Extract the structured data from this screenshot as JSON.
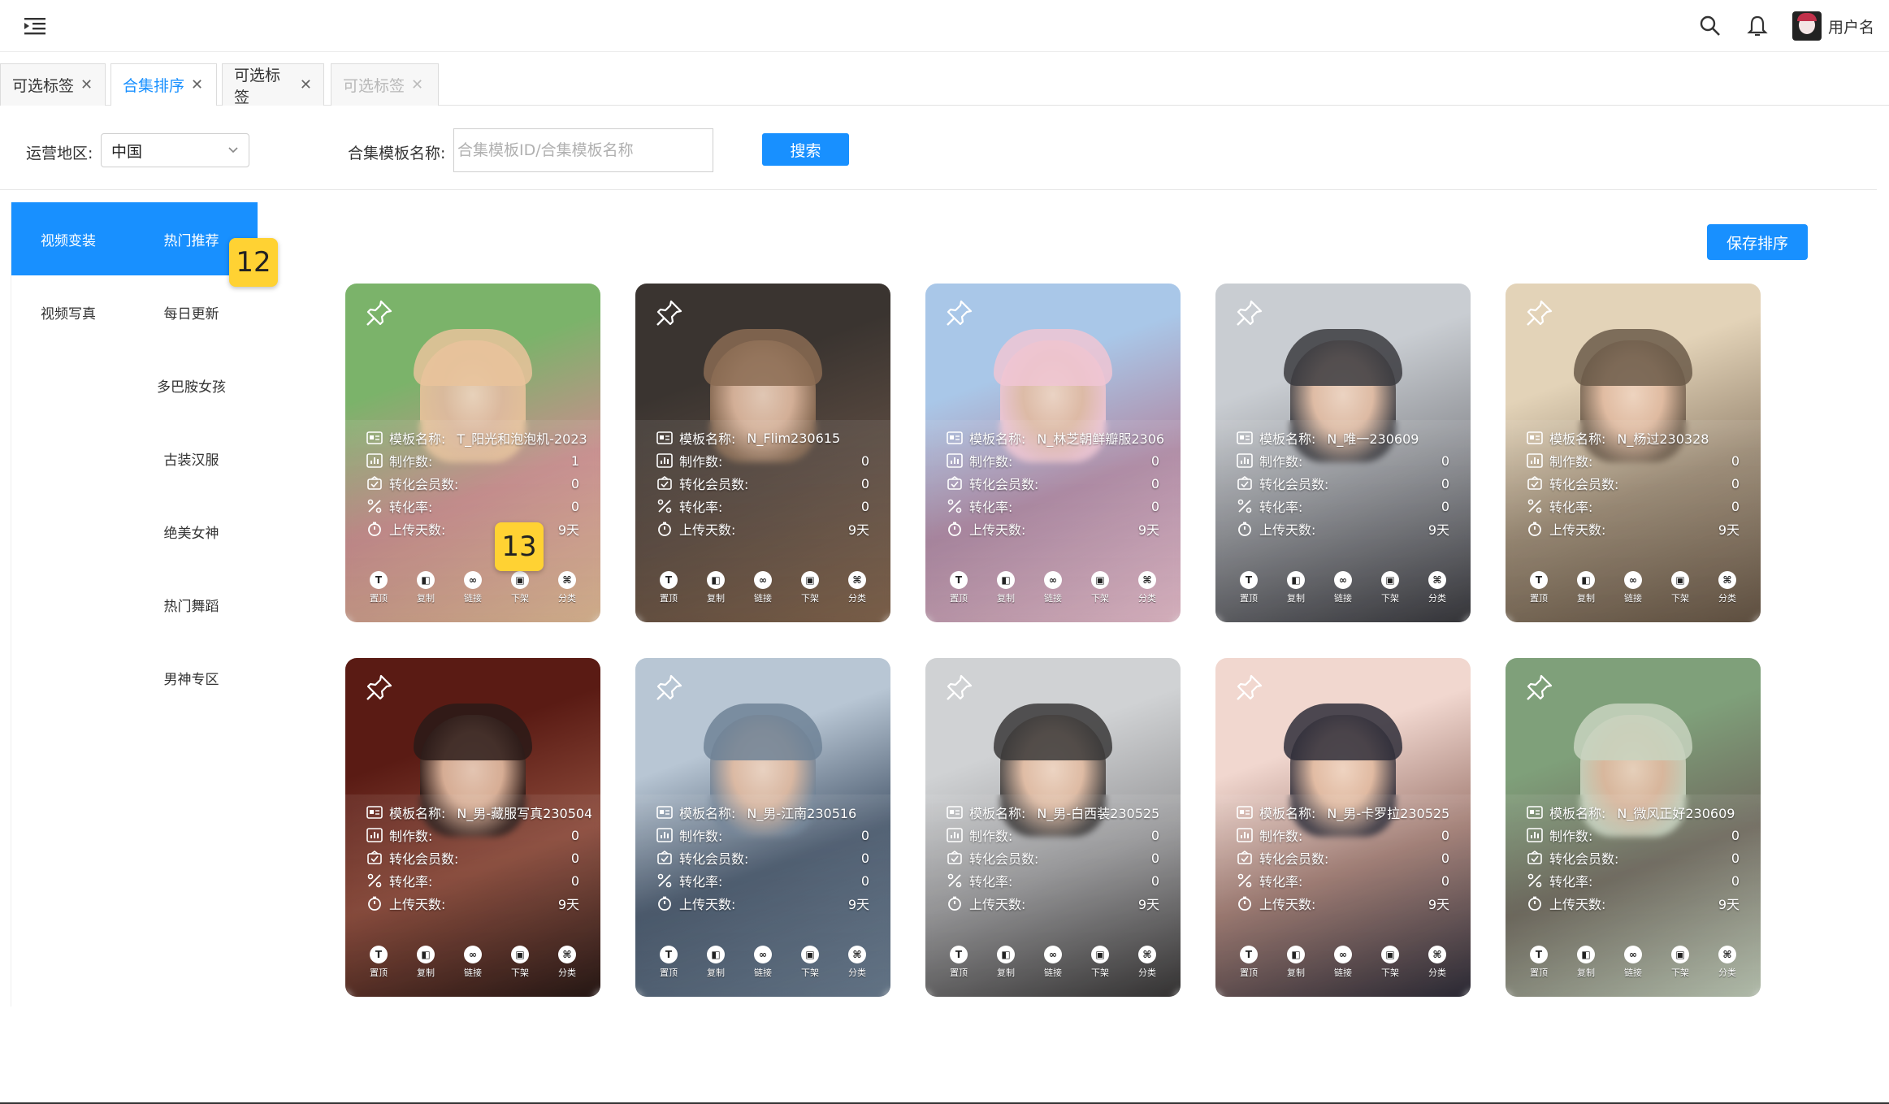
{
  "header": {
    "user_name": "用户名",
    "icons": [
      "menu-fold-icon",
      "search-icon",
      "bell-icon",
      "avatar"
    ]
  },
  "tabs": [
    {
      "label": "可选标签",
      "state": "normal"
    },
    {
      "label": "合集排序",
      "state": "active"
    },
    {
      "label": "可选标签",
      "state": "normal"
    },
    {
      "label": "可选标签",
      "state": "disabled"
    }
  ],
  "filter": {
    "region_label": "运营地区:",
    "region_value": "中国",
    "template_label": "合集模板名称:",
    "template_placeholder": "合集模板ID/合集模板名称",
    "search_label": "搜索"
  },
  "sidebar": {
    "rows": [
      {
        "left": "视频变装",
        "right": "热门推荐",
        "active": true
      },
      {
        "left": "视频写真",
        "right": "每日更新"
      },
      {
        "left": "",
        "right": "多巴胺女孩"
      },
      {
        "left": "",
        "right": "古装汉服"
      },
      {
        "left": "",
        "right": "绝美女神"
      },
      {
        "left": "",
        "right": "热门舞蹈"
      },
      {
        "left": "",
        "right": "男神专区"
      }
    ]
  },
  "badges": [
    "12",
    "13"
  ],
  "save_label": "保存排序",
  "field_labels": {
    "name": "模板名称:",
    "count": "制作数:",
    "members": "转化会员数:",
    "rate": "转化率:",
    "days": "上传天数:"
  },
  "action_labels": [
    "置顶",
    "复制",
    "链接",
    "下架",
    "分类"
  ],
  "action_glyphs": [
    "T",
    "◧",
    "∞",
    "▣",
    "⌘"
  ],
  "cards": [
    {
      "name": "T_阳光和泡泡机-2023",
      "count": "1",
      "members": "0",
      "rate": "0",
      "days": "9天",
      "palette": [
        "#7bb36a",
        "#e9c39b",
        "#c98d8d"
      ]
    },
    {
      "name": "N_Flim230615",
      "count": "0",
      "members": "0",
      "rate": "0",
      "days": "9天",
      "palette": [
        "#3a3430",
        "#8a6b52",
        "#5a4a40"
      ]
    },
    {
      "name": "N_林芝朝鲜瓣服2306",
      "count": "0",
      "members": "0",
      "rate": "0",
      "days": "9天",
      "palette": [
        "#a9c7e8",
        "#f0c6d4",
        "#b08aa5"
      ]
    },
    {
      "name": "N_唯一230609",
      "count": "0",
      "members": "0",
      "rate": "0",
      "days": "9天",
      "palette": [
        "#c9cdd2",
        "#3b3b40",
        "#8d8f94"
      ]
    },
    {
      "name": "N_杨过230328",
      "count": "0",
      "members": "0",
      "rate": "0",
      "days": "9天",
      "palette": [
        "#e3d3b8",
        "#6b5a49",
        "#9b8a74"
      ]
    },
    {
      "name": "N_男-藏服写真230504",
      "count": "0",
      "members": "0",
      "rate": "0",
      "days": "9天",
      "palette": [
        "#5a1b14",
        "#2a1a17",
        "#8c4a3a"
      ]
    },
    {
      "name": "N_男-江南230516",
      "count": "0",
      "members": "0",
      "rate": "0",
      "days": "9天",
      "palette": [
        "#b8c6d4",
        "#6f8296",
        "#4a5a6e"
      ]
    },
    {
      "name": "N_男-白西装230525",
      "count": "0",
      "members": "0",
      "rate": "0",
      "days": "9天",
      "palette": [
        "#d0d2d4",
        "#3a3838",
        "#9a9a9c"
      ]
    },
    {
      "name": "N_男-卡罗拉230525",
      "count": "0",
      "members": "0",
      "rate": "0",
      "days": "9天",
      "palette": [
        "#f1d7cf",
        "#2f2e3a",
        "#a27d74"
      ]
    },
    {
      "name": "N_微风正好230609",
      "count": "0",
      "members": "0",
      "rate": "0",
      "days": "9天",
      "palette": [
        "#7fa07a",
        "#c8d4c0",
        "#6f6a5e"
      ]
    }
  ]
}
